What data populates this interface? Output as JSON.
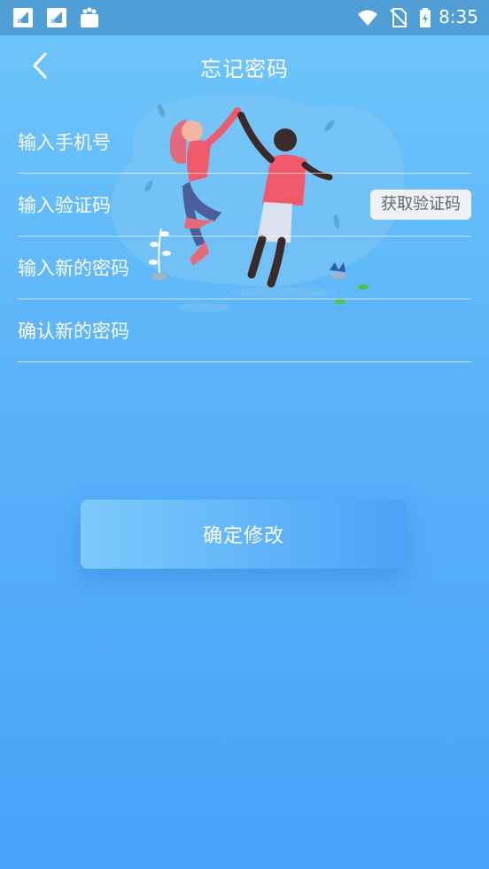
{
  "status_bar": {
    "time": "8:35",
    "icons": [
      "app-notification-icon",
      "app-notification-icon",
      "shopping-bag-icon",
      "wifi-icon",
      "no-sim-icon",
      "battery-charging-icon"
    ]
  },
  "header": {
    "title": "忘记密码",
    "back_icon": "chevron-left-icon"
  },
  "form": {
    "phone_placeholder": "输入手机号",
    "code_placeholder": "输入验证码",
    "get_code_label": "获取验证码",
    "new_password_placeholder": "输入新的密码",
    "confirm_password_placeholder": "确认新的密码"
  },
  "actions": {
    "confirm_label": "确定修改"
  },
  "colors": {
    "background_top": "#6ec6fb",
    "background_bottom": "#47a3f8",
    "status_bar": "#4f9fd6",
    "code_button_bg": "#eef2f5",
    "illustration_shirt": "#f05a6b"
  }
}
